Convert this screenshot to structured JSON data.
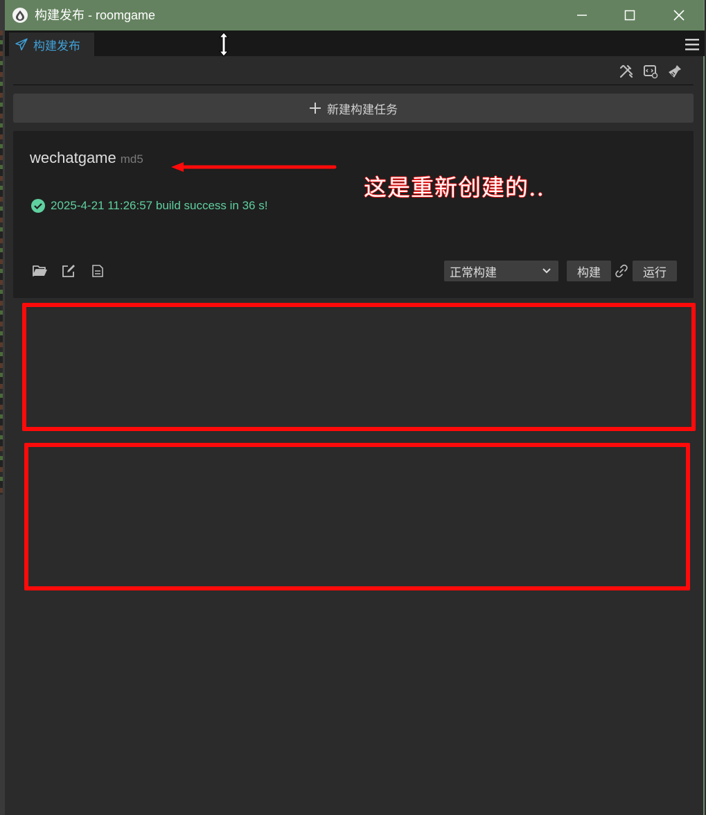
{
  "window": {
    "title": "构建发布 - roomgame",
    "title_bar_color": "#64825f"
  },
  "tabs": [
    {
      "label": "构建发布",
      "icon": "paper-plane-icon",
      "active": true,
      "color": "#3fa0d8"
    }
  ],
  "toolbar": {
    "icons": [
      "tools-icon",
      "code-settings-icon",
      "broom-icon"
    ]
  },
  "new_task_button": {
    "label": "新建构建任务",
    "icon": "plus-icon"
  },
  "build_task": {
    "platform": "wechatgame",
    "tag": "md5",
    "status_text": "2025-4-21 11:26:57 build success in 36 s!",
    "status_color": "#5fd0a0",
    "action_icons": [
      "folder-open-icon",
      "edit-icon",
      "log-file-icon"
    ],
    "build_mode": {
      "selected": "正常构建"
    },
    "build_label": "构建",
    "run_label": "运行"
  },
  "annotations": {
    "note": "这是重新创建的..",
    "color": "#ff0a0a"
  }
}
